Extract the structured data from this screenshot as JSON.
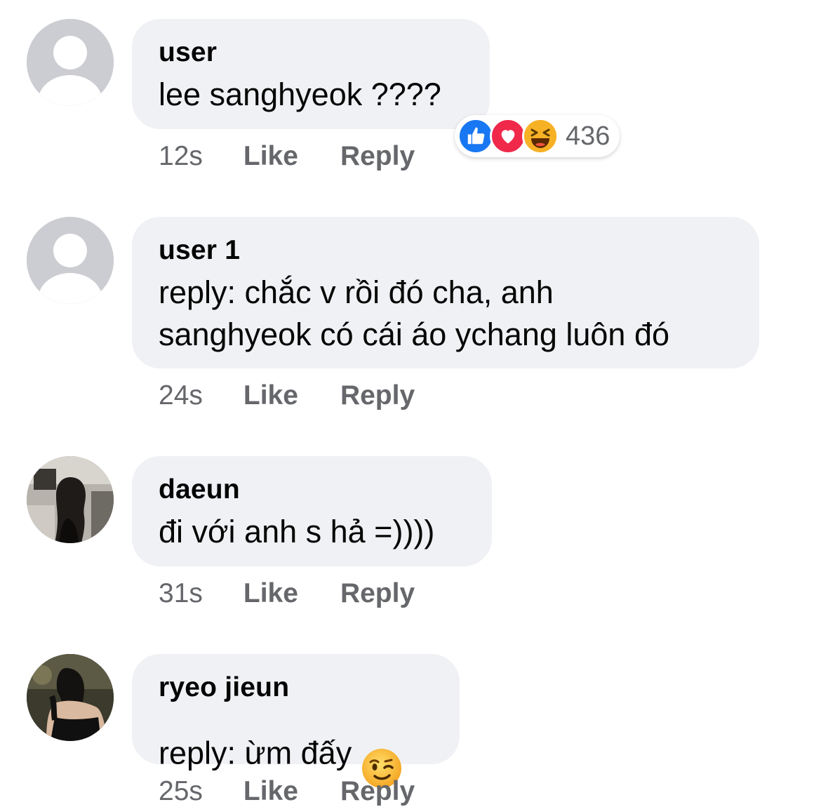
{
  "comments": [
    {
      "author": "user",
      "text": "lee sanghyeok ????",
      "time": "12s",
      "like_label": "Like",
      "reply_label": "Reply",
      "reactions": {
        "icons": [
          "like-icon",
          "love-icon",
          "haha-icon"
        ],
        "count": "436"
      }
    },
    {
      "author": "user 1",
      "text": "reply: chắc v rồi đó cha, anh\nsanghyeok có cái áo ychang luôn đó",
      "time": "24s",
      "like_label": "Like",
      "reply_label": "Reply"
    },
    {
      "author": "daeun",
      "text": "đi với anh s hả =))))",
      "time": "31s",
      "like_label": "Like",
      "reply_label": "Reply"
    },
    {
      "author": "ryeo jieun",
      "text": "reply: ừm đấy",
      "emoji": "winking-face-icon",
      "time": "25s",
      "like_label": "Like",
      "reply_label": "Reply"
    }
  ],
  "colors": {
    "bubble": "#f0f1f4",
    "meta_text": "#65676b",
    "like_blue": "#1877f2",
    "love_red": "#f0284a",
    "haha_yellow": "#f7b125"
  }
}
